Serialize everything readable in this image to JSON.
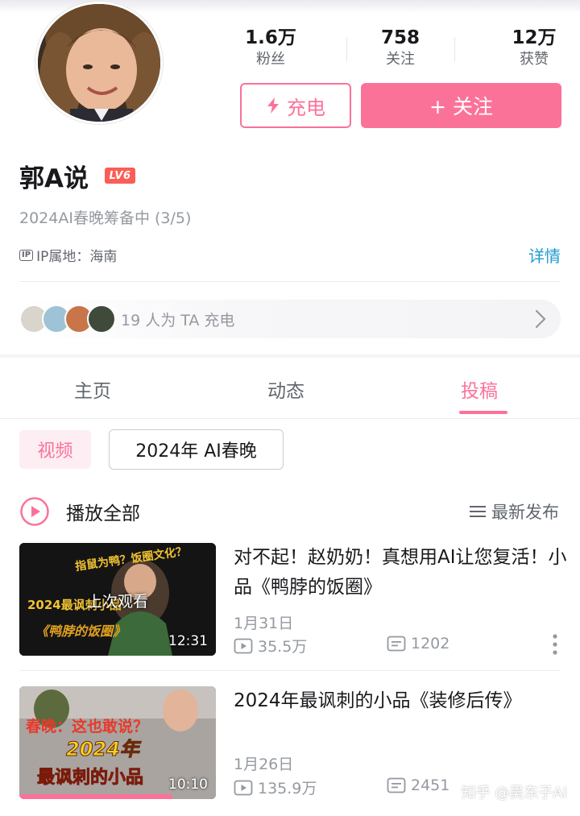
{
  "profile": {
    "username": "郭A说",
    "level_badge": "LV6",
    "signature": "2024AI春晚筹备中 (3/5)",
    "ip_tag": "IP",
    "ip_location": "IP属地：海南",
    "details_link": "详情"
  },
  "stats": [
    {
      "value": "1.6万",
      "label": "粉丝"
    },
    {
      "value": "758",
      "label": "关注"
    },
    {
      "value": "12万",
      "label": "获赞"
    }
  ],
  "buttons": {
    "charge": "充电",
    "follow": "+ 关注"
  },
  "charge_bar": {
    "text": "19 人为 TA 充电"
  },
  "tabs": [
    {
      "label": "主页",
      "active": false
    },
    {
      "label": "动态",
      "active": false
    },
    {
      "label": "投稿",
      "active": true
    }
  ],
  "filter_chips": {
    "video": "视频",
    "album": "2024年 AI春晚"
  },
  "list_header": {
    "play_all": "播放全部",
    "sort": "最新发布"
  },
  "videos": [
    {
      "title": "对不起！赵奶奶！真想用AI让您复活！小品《鸭脖的饭圈》",
      "date": "1月31日",
      "views": "35.5万",
      "comments": "1202",
      "duration": "12:31",
      "last_watched": "上次观看",
      "thumb_lines": [
        "指鼠为鸭？饭圈文化？",
        "2024最讽刺小品",
        "《鸭脖的饭圈》"
      ]
    },
    {
      "title": "2024年最讽刺的小品《装修后传》",
      "date": "1月26日",
      "views": "135.9万",
      "comments": "2451",
      "duration": "10:10",
      "thumb_lines": [
        "春晚：这也敢说？",
        "2024年",
        "最讽刺的小品"
      ]
    }
  ],
  "watermark": "知乎 @吴东子AI",
  "colors": {
    "accent": "#fb7299",
    "link": "#1e9bd0",
    "level": "#fb5e57"
  }
}
